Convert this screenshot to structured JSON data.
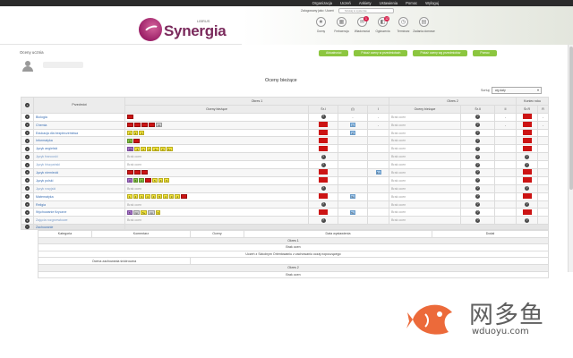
{
  "topnav": [
    "Organizacja",
    "Uczeń",
    "Ankiety",
    "Ustawienia",
    "Pomoc",
    "Wyloguj"
  ],
  "header": {
    "logo_sub": "LIBRUS",
    "logo": "Synergia",
    "user_line": "Zalogowany jako: Uczeń",
    "search_placeholder": "Szukaj w systemie"
  },
  "icons": [
    {
      "label": "Oceny",
      "icon": "star-icon",
      "badge": ""
    },
    {
      "label": "Frekwencja",
      "icon": "calendar-icon",
      "badge": ""
    },
    {
      "label": "Wiadomości",
      "icon": "mail-icon",
      "badge": "1"
    },
    {
      "label": "Ogłoszenia",
      "icon": "megaphone-icon",
      "badge": "12"
    },
    {
      "label": "Terminarz",
      "icon": "clock-icon",
      "badge": ""
    },
    {
      "label": "Zadania domowe",
      "icon": "notebook-icon",
      "badge": ""
    }
  ],
  "crumb": "Oceny ucznia",
  "action_buttons": [
    "Aktualności",
    "Pokaż oceny w przedmiotach",
    "Pokaż oceny wg przedmiotów",
    "Pomoc"
  ],
  "page_title": "Oceny bieżące",
  "filter": {
    "label": "Sortuj:",
    "value": "wg daty"
  },
  "grades": {
    "headers": {
      "subject": "Przedmiot",
      "sem1": "Okres 1",
      "sem2": "Okres 2",
      "current": "Oceny bieżące",
      "sr": "Śr.I",
      "i": "(I)",
      "final": "I",
      "cur2": "Oceny bieżące",
      "sr2": "Śr.II",
      "ii": "II",
      "final_year": "Koniec roku",
      "sr_r": "Śr.R",
      "r": "R"
    },
    "rows": [
      {
        "subject": "Biologia",
        "dim": false,
        "cells": [
          {
            "c": "red",
            "t": ""
          }
        ],
        "text1": "Brak ocen",
        "avg1": "?",
        "avg1type": "q",
        "col_i": "-",
        "col_I": "-",
        "text2": "Brak ocen",
        "avg2": "?",
        "col_ii": "-",
        "sr_r": "red",
        "r": "-"
      },
      {
        "subject": "Chemia",
        "dim": false,
        "cells": [
          {
            "c": "red",
            "t": ""
          },
          {
            "c": "red",
            "t": ""
          },
          {
            "c": "red",
            "t": ""
          },
          {
            "c": "red",
            "t": ""
          },
          {
            "c": "gray",
            "t": "np"
          }
        ],
        "text1": "",
        "avg1": "",
        "avg1type": "red",
        "col_i": "1",
        "col_I": "-",
        "text2": "Brak ocen",
        "avg2": "?",
        "col_ii": "-",
        "sr_r": "red",
        "r": "-"
      },
      {
        "subject": "Edukacja dla bezpieczeństwa",
        "dim": false,
        "cells": [
          {
            "c": "yellow",
            "t": "3"
          },
          {
            "c": "yellow",
            "t": "2"
          },
          {
            "c": "yellow",
            "t": "3"
          }
        ],
        "text1": "",
        "avg1": "",
        "avg1type": "red",
        "col_i": "2",
        "col_I": "",
        "text2": "Brak ocen",
        "avg2": "?",
        "col_ii": "",
        "sr_r": "red",
        "r": ""
      },
      {
        "subject": "Informatyka",
        "dim": false,
        "cells": [
          {
            "c": "green",
            "t": "5"
          },
          {
            "c": "red",
            "t": ""
          }
        ],
        "text1": "",
        "avg1": "",
        "avg1type": "red",
        "col_i": "",
        "col_I": "",
        "text2": "Brak ocen",
        "avg2": "?",
        "col_ii": "",
        "sr_r": "red",
        "r": ""
      },
      {
        "subject": "Język angielski",
        "dim": false,
        "cells": [
          {
            "c": "purple",
            "t": "3+"
          },
          {
            "c": "yellow",
            "t": "4"
          },
          {
            "c": "yellow",
            "t": "4"
          },
          {
            "c": "yellow",
            "t": "3"
          },
          {
            "c": "yellow",
            "t": "4+"
          },
          {
            "c": "yellow",
            "t": "3"
          },
          {
            "c": "yellow",
            "t": "4+"
          }
        ],
        "text1": "",
        "avg1": "",
        "avg1type": "red",
        "col_i": "",
        "col_I": "",
        "text2": "Brak ocen",
        "avg2": "?",
        "col_ii": "",
        "sr_r": "red",
        "r": ""
      },
      {
        "subject": "Język francuski",
        "dim": true,
        "cells": [],
        "text1": "Brak ocen",
        "avg1": "?",
        "avg1type": "q",
        "col_i": "",
        "col_I": "",
        "text2": "Brak ocen",
        "avg2": "?",
        "col_ii": "",
        "sr_r": "q",
        "r": ""
      },
      {
        "subject": "Język hiszpański",
        "dim": true,
        "cells": [],
        "text1": "Brak ocen",
        "avg1": "?",
        "avg1type": "q",
        "col_i": "",
        "col_I": "",
        "text2": "Brak ocen",
        "avg2": "?",
        "col_ii": "",
        "sr_r": "q",
        "r": ""
      },
      {
        "subject": "Język niemiecki",
        "dim": false,
        "cells": [
          {
            "c": "red",
            "t": ""
          },
          {
            "c": "red",
            "t": ""
          },
          {
            "c": "red",
            "t": ""
          }
        ],
        "text1": "",
        "avg1": "",
        "avg1type": "red",
        "col_i": "",
        "col_I": "1+",
        "text2": "Brak ocen",
        "avg2": "?",
        "col_ii": "",
        "sr_r": "red",
        "r": ""
      },
      {
        "subject": "Język polski",
        "dim": false,
        "cells": [
          {
            "c": "purple",
            "t": "3"
          },
          {
            "c": "green",
            "t": "5"
          },
          {
            "c": "green",
            "t": "4"
          },
          {
            "c": "red",
            "t": ""
          },
          {
            "c": "yellow",
            "t": "5"
          },
          {
            "c": "yellow",
            "t": "4"
          },
          {
            "c": "yellow",
            "t": "5"
          }
        ],
        "text1": "",
        "avg1": "",
        "avg1type": "red",
        "col_i": "",
        "col_I": "",
        "text2": "Brak ocen",
        "avg2": "?",
        "col_ii": "",
        "sr_r": "red",
        "r": ""
      },
      {
        "subject": "Język rosyjski",
        "dim": true,
        "cells": [],
        "text1": "Brak ocen",
        "avg1": "?",
        "avg1type": "q",
        "col_i": "",
        "col_I": "",
        "text2": "Brak ocen",
        "avg2": "?",
        "col_ii": "",
        "sr_r": "q",
        "r": ""
      },
      {
        "subject": "Matematyka",
        "dim": false,
        "cells": [
          {
            "c": "yellow",
            "t": "1"
          },
          {
            "c": "yellow",
            "t": "4"
          },
          {
            "c": "yellow",
            "t": "3"
          },
          {
            "c": "yellow",
            "t": "4"
          },
          {
            "c": "yellow",
            "t": "4"
          },
          {
            "c": "yellow",
            "t": "5"
          },
          {
            "c": "yellow",
            "t": "4"
          },
          {
            "c": "yellow",
            "t": "3"
          },
          {
            "c": "yellow",
            "t": "4"
          },
          {
            "c": "red",
            "t": ""
          }
        ],
        "text1": "",
        "avg1": "",
        "avg1type": "red",
        "col_i": "3+",
        "col_I": "",
        "text2": "Brak ocen",
        "avg2": "?",
        "col_ii": "",
        "sr_r": "red",
        "r": ""
      },
      {
        "subject": "Religia",
        "dim": false,
        "cells": [],
        "text1": "Brak ocen",
        "avg1": "?",
        "avg1type": "q",
        "col_i": "",
        "col_I": "",
        "text2": "Brak ocen",
        "avg2": "?",
        "col_ii": "",
        "sr_r": "q",
        "r": ""
      },
      {
        "subject": "Wychowanie fizyczne",
        "dim": false,
        "cells": [
          {
            "c": "purple",
            "t": "5"
          },
          {
            "c": "gray",
            "t": "np"
          },
          {
            "c": "yellow",
            "t": "5+"
          },
          {
            "c": "gray",
            "t": "np"
          },
          {
            "c": "yellow",
            "t": "6"
          }
        ],
        "text1": "",
        "avg1": "",
        "avg1type": "red",
        "col_i": "5+",
        "col_I": "",
        "text2": "Brak ocen",
        "avg2": "?",
        "col_ii": "",
        "sr_r": "red",
        "r": ""
      },
      {
        "subject": "Zajęcia rozgrzewkowe",
        "dim": true,
        "cells": [],
        "text1": "Brak ocen",
        "avg1": "?",
        "avg1type": "q",
        "col_i": "",
        "col_I": "",
        "text2": "Brak ocen",
        "avg2": "?",
        "col_ii": "",
        "sr_r": "q",
        "r": ""
      }
    ],
    "summary_label": "Zachowanie"
  },
  "details": {
    "headers": [
      "Kategoria",
      "Komentarz",
      "Oceny",
      "Data wystawienia",
      "Dodał"
    ],
    "sem1_title": "Okres 1",
    "sem1_rows": [
      "Brak ocen",
      "Uczeń z Szkolnym Orientowaniu z zachowaniu oczaj nopoczącego",
      "Ocena zachowania śródroczna"
    ],
    "sem2_title": "Okres 2",
    "sem2_rows": [
      "Brak ocen"
    ]
  },
  "watermark": {
    "cn": "网多鱼",
    "url": "wduoyu.com"
  },
  "colors": {
    "accent_green": "#8cc63f",
    "grade_red": "#cc1414",
    "brand_plum": "#7a2a5c"
  }
}
